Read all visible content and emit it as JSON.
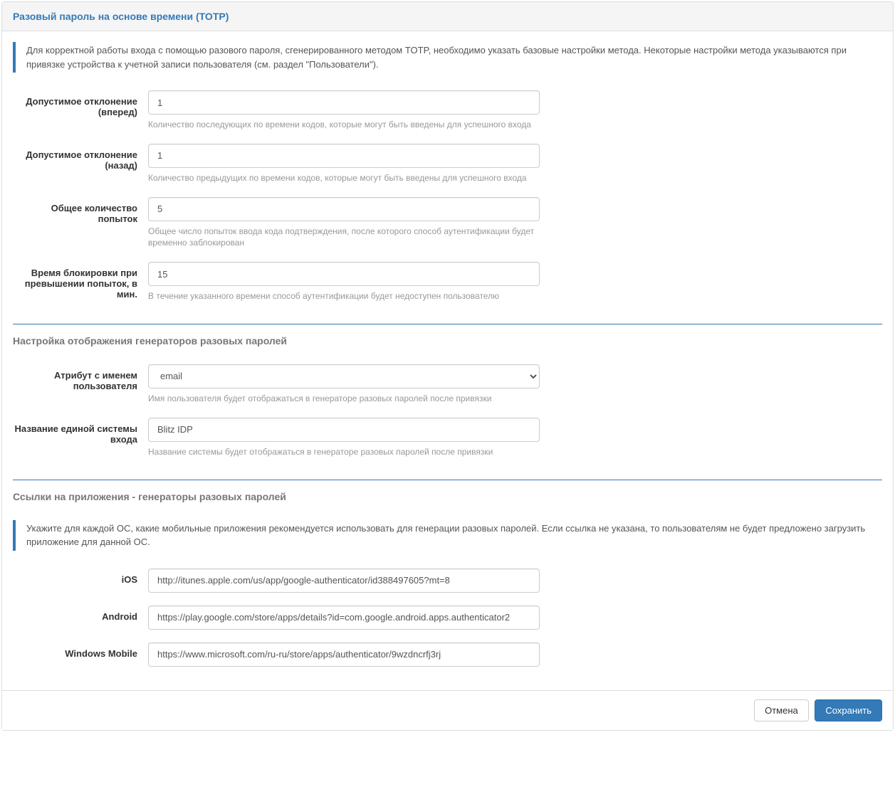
{
  "panel": {
    "title": "Разовый пароль на основе времени (TOTP)"
  },
  "intro": {
    "text": "Для корректной работы входа с помощью разового пароля, сгенерированного методом TOTP, необходимо указать базовые настройки метода. Некоторые настройки метода указываются при привязке устройства к учетной записи пользователя (см. раздел \"Пользователи\")."
  },
  "fields": {
    "forward": {
      "label": "Допустимое отклонение (вперед)",
      "value": "1",
      "help": "Количество последующих по времени кодов, которые могут быть введены для успешного входа"
    },
    "backward": {
      "label": "Допустимое отклонение (назад)",
      "value": "1",
      "help": "Количество предыдущих по времени кодов, которые могут быть введены для успешного входа"
    },
    "attempts": {
      "label": "Общее количество попыток",
      "value": "5",
      "help": "Общее число попыток ввода кода подтверждения, после которого способ аутентификации будет временно заблокирован"
    },
    "locktime": {
      "label": "Время блокировки при превышении попыток, в мин.",
      "value": "15",
      "help": "В течение указанного времени способ аутентификации будет недоступен пользователю"
    }
  },
  "section_display": {
    "heading": "Настройка отображения генераторов разовых паролей",
    "username_attr": {
      "label": "Атрибут с именем пользователя",
      "value": "email",
      "help": "Имя пользователя будет отображаться в генераторе разовых паролей после привязки"
    },
    "system_name": {
      "label": "Название единой системы входа",
      "value": "Blitz IDP",
      "help": "Название системы будет отображаться в генераторе разовых паролей после привязки"
    }
  },
  "section_links": {
    "heading": "Ссылки на приложения - генераторы разовых паролей",
    "info": "Укажите для каждой ОС, какие мобильные приложения рекомендуется использовать для генерации разовых паролей. Если ссылка не указана, то пользователям не будет предложено загрузить приложение для данной ОС.",
    "ios": {
      "label": "iOS",
      "value": "http://itunes.apple.com/us/app/google-authenticator/id388497605?mt=8"
    },
    "android": {
      "label": "Android",
      "value": "https://play.google.com/store/apps/details?id=com.google.android.apps.authenticator2"
    },
    "windows": {
      "label": "Windows Mobile",
      "value": "https://www.microsoft.com/ru-ru/store/apps/authenticator/9wzdncrfj3rj"
    }
  },
  "buttons": {
    "cancel": "Отмена",
    "save": "Сохранить"
  }
}
